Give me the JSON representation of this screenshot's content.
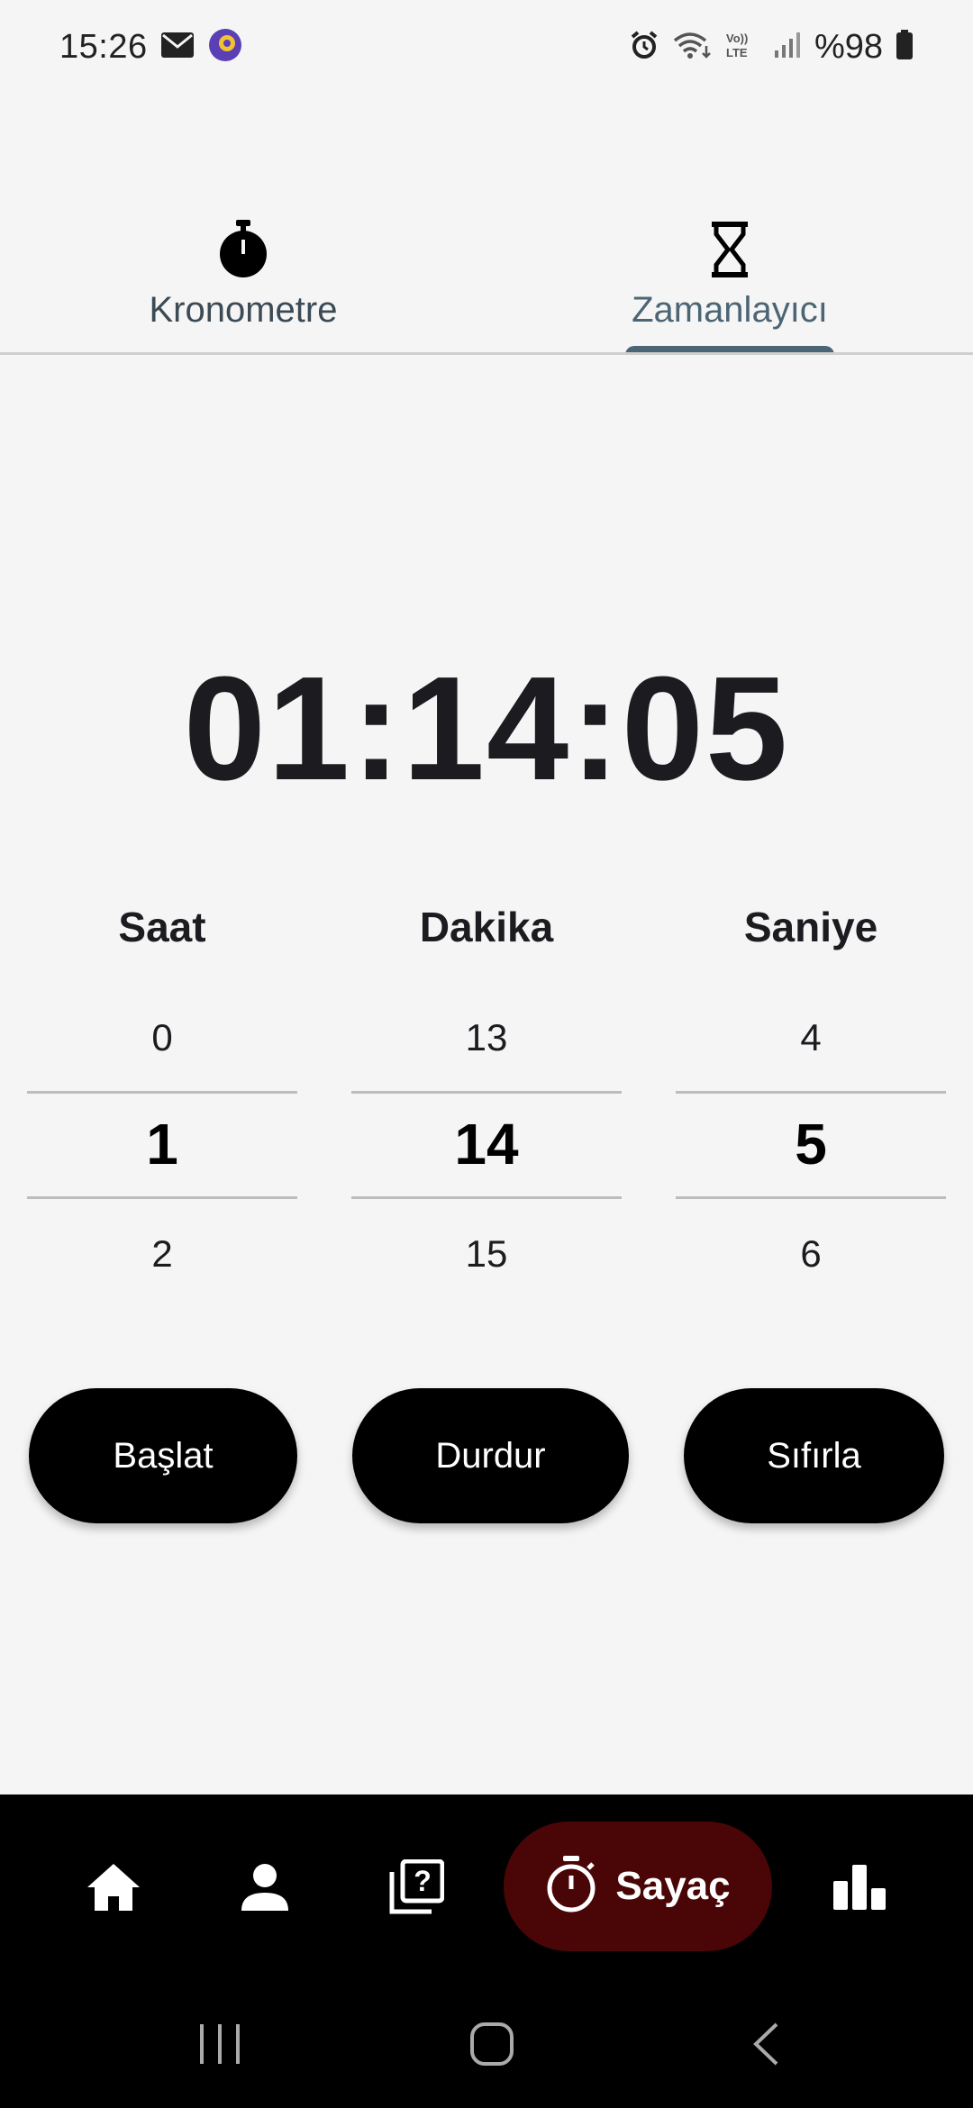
{
  "status_bar": {
    "time": "15:26",
    "battery": "%98",
    "icons": [
      "mail-icon",
      "app-notification-icon",
      "alarm-icon",
      "wifi-icon",
      "volte-icon",
      "signal-icon",
      "battery-icon"
    ]
  },
  "tabs": [
    {
      "label": "Kronometre",
      "icon": "stopwatch-icon",
      "active": false
    },
    {
      "label": "Zamanlayıcı",
      "icon": "hourglass-icon",
      "active": true
    }
  ],
  "timer": {
    "display": "01:14:05"
  },
  "pickers": [
    {
      "header": "Saat",
      "prev": "0",
      "current": "1",
      "next": "2"
    },
    {
      "header": "Dakika",
      "prev": "13",
      "current": "14",
      "next": "15"
    },
    {
      "header": "Saniye",
      "prev": "4",
      "current": "5",
      "next": "6"
    }
  ],
  "actions": {
    "start": "Başlat",
    "stop": "Durdur",
    "reset": "Sıfırla"
  },
  "bottom_nav": {
    "items": [
      "home-icon",
      "profile-icon",
      "quiz-icon",
      "timer-icon",
      "stats-icon"
    ],
    "active_label": "Sayaç",
    "active_color": "#4a0606"
  },
  "colors": {
    "accent": "#4c6574",
    "background": "#f5f5f5",
    "button": "#000000"
  }
}
